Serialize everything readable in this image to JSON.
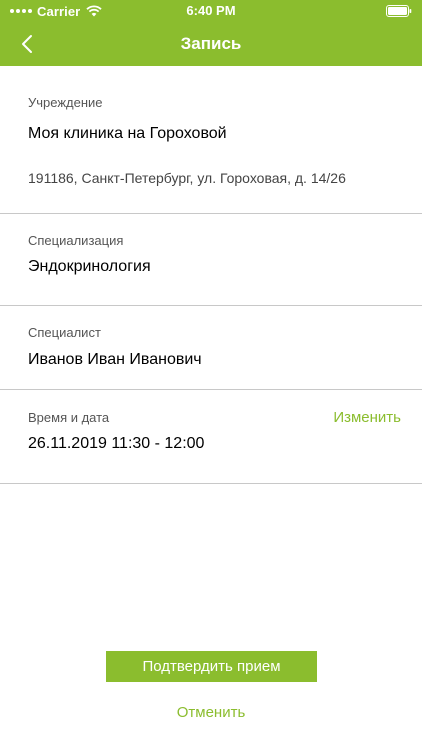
{
  "status_bar": {
    "carrier": "Carrier",
    "time": "6:40 PM"
  },
  "nav": {
    "title": "Запись",
    "back_icon": "chevron-left-icon"
  },
  "institution": {
    "label": "Учреждение",
    "name": "Моя клиника на Гороховой",
    "address": "191186, Санкт-Петербург, ул. Гороховая, д. 14/26"
  },
  "specialization": {
    "label": "Специализация",
    "value": "Эндокринология"
  },
  "specialist": {
    "label": "Специалист",
    "value": "Иванов Иван Иванович"
  },
  "datetime": {
    "label": "Время и дата",
    "value": "26.11.2019 11:30 - 12:00",
    "change_label": "Изменить"
  },
  "actions": {
    "confirm_label": "Подтвердить прием",
    "cancel_label": "Отменить"
  },
  "colors": {
    "accent": "#8bbd2e",
    "divider": "#c8c8c8"
  }
}
